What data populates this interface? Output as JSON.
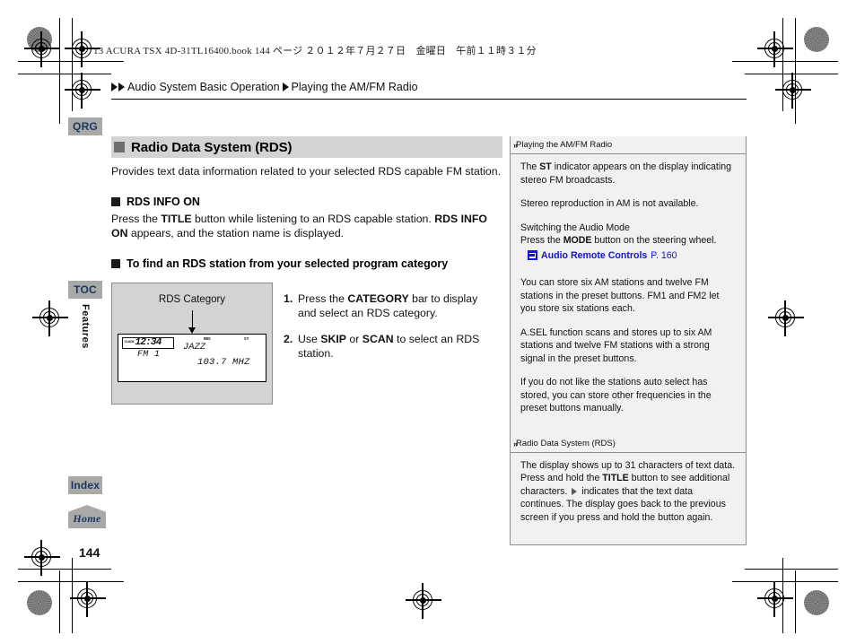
{
  "print_header": "13 ACURA TSX 4D-31TL16400.book  144 ページ  ２０１２年７月２７日　金曜日　午前１１時３１分",
  "breadcrumb": {
    "parent": "Audio System Basic Operation",
    "child": "Playing the AM/FM Radio"
  },
  "tabs": {
    "qrg": "QRG",
    "toc": "TOC",
    "features": "Features",
    "index": "Index",
    "home": "Home"
  },
  "page_number": "144",
  "main": {
    "section_title": "Radio Data System (RDS)",
    "intro": "Provides text data information related to your selected RDS capable FM station.",
    "sub1_title": "RDS INFO ON",
    "sub1_body_1": "Press the ",
    "sub1_body_bold1": "TITLE",
    "sub1_body_2": " button while listening to an RDS capable station. ",
    "sub1_body_bold2": "RDS INFO ON",
    "sub1_body_3": " appears, and the station name is displayed.",
    "sub2_title": "To find an RDS station from your selected program category",
    "illustration": {
      "caption": "RDS Category",
      "lcd": {
        "clock_label": "CLOCK",
        "clock_value": "12:34",
        "band": "FM 1",
        "rds_label": "RDS",
        "category": "JAZZ",
        "stereo_label": "ST",
        "frequency": "103.7 MHZ"
      }
    },
    "steps": [
      {
        "num": "1.",
        "pre": "Press the ",
        "bold": "CATEGORY",
        "post": " bar to display and select an RDS category."
      },
      {
        "num": "2.",
        "pre": "Use ",
        "bold": "SKIP",
        "mid": " or ",
        "bold2": "SCAN",
        "post": " to select an RDS station."
      }
    ]
  },
  "side": {
    "block1": {
      "heading": "Playing the AM/FM Radio",
      "p1_pre": "The ",
      "p1_bold": "ST",
      "p1_post": " indicator appears on the display indicating stereo FM broadcasts.",
      "p2": "Stereo reproduction in AM is not available.",
      "p3_line1": "Switching the Audio Mode",
      "p3_line2_pre": "Press the ",
      "p3_line2_bold": "MODE",
      "p3_line2_post": " button on the steering wheel.",
      "ref_name": "Audio Remote Controls",
      "ref_page": "P. 160",
      "p4": "You can store six AM stations and twelve FM stations in the preset buttons. FM1 and FM2 let you store six stations each.",
      "p5": "A.SEL function scans and stores up to six AM stations and twelve FM stations with a strong signal in the preset buttons.",
      "p6": "If you do not like the stations auto select has stored, you can store other frequencies in the preset buttons manually."
    },
    "block2": {
      "heading": "Radio Data System (RDS)",
      "p1_pre": "The display shows up to 31 characters of text data. Press and hold the ",
      "p1_bold": "TITLE",
      "p1_mid": " button to see additional characters. ",
      "p1_post": " indicates that the text data continues. The display goes back to the previous screen if you press and hold the button again."
    }
  },
  "colors": {
    "tab_bg": "#a9aaa8",
    "tab_text": "#1b365d",
    "section_bar": "#d3d3d3",
    "link_blue": "#1414d2",
    "side_bg": "#f1f1f1"
  }
}
